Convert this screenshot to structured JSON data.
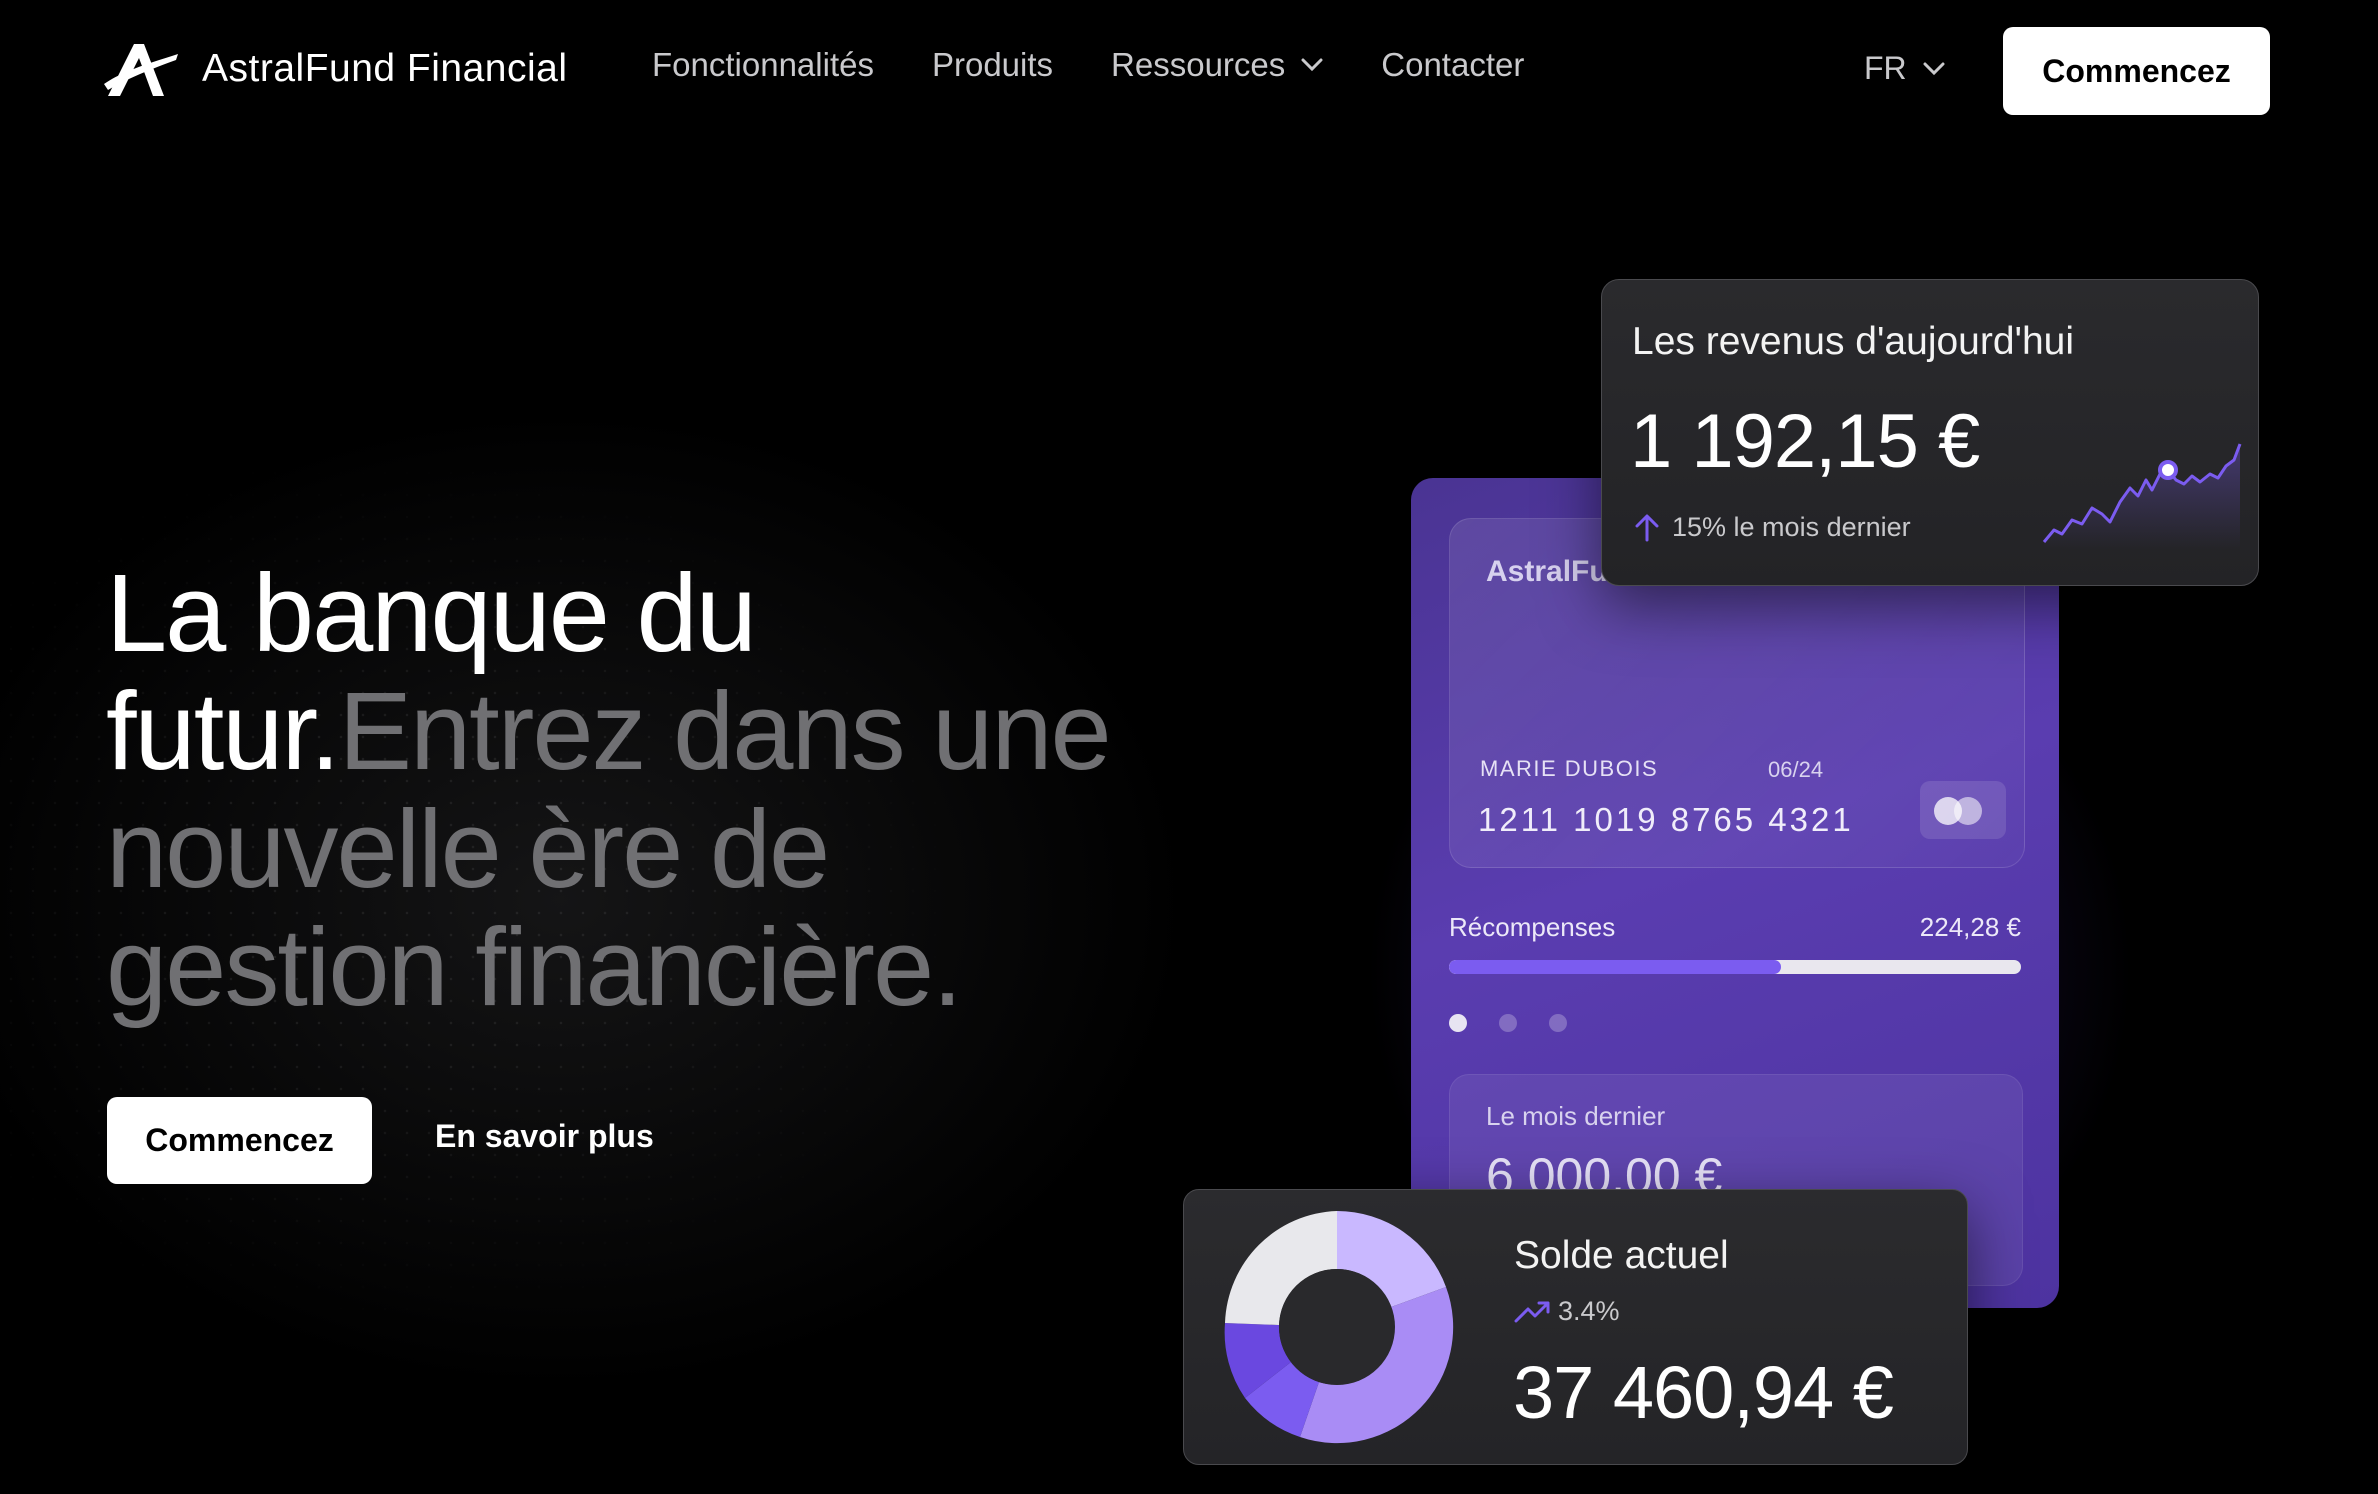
{
  "brand": {
    "name": "AstralFund Financial",
    "logo_icon": "astral-a-logo-icon"
  },
  "nav": {
    "links": [
      {
        "label": "Fonctionnalités"
      },
      {
        "label": "Produits"
      },
      {
        "label": "Ressources",
        "icon": "chevron-down-icon"
      },
      {
        "label": "Contacter"
      }
    ],
    "language": "FR",
    "cta": "Commencez"
  },
  "hero": {
    "heading_white": "La banque du futur.",
    "heading_gray": "Entrez dans une nouvelle ère de gestion financière.",
    "primary_cta": "Commencez",
    "secondary_cta": "En savoir plus"
  },
  "card": {
    "brand": "AstralFund",
    "holder": "MARIE DUBOIS",
    "expiry": "06/24",
    "number": "1211  1019  8765  4321",
    "network_icon": "mastercard-icon",
    "rewards_label": "Récompenses",
    "rewards_value": "224,28 €",
    "rewards_progress": 0.58,
    "pagination": {
      "count": 3,
      "active": 0
    },
    "last_month_label": "Le mois dernier",
    "last_month_value": "6 000,00 €"
  },
  "revenue": {
    "title": "Les revenus d'aujourd'hui",
    "value": "1 192,15 €",
    "trend": "15% le mois dernier",
    "trend_icon": "arrow-up-icon",
    "accent": "#7b5cf0"
  },
  "balance": {
    "title": "Solde actuel",
    "trend": "3.4%",
    "trend_icon": "trending-up-icon",
    "value": "37 460,94 €",
    "donut_colors": [
      "#c9b8ff",
      "#a98cf5",
      "#7b5cf0",
      "#6a48e0",
      "#e8e8ec"
    ]
  },
  "colors": {
    "background": "#000000",
    "accent": "#7b5cf0",
    "card_purple": "#5a3db0"
  }
}
